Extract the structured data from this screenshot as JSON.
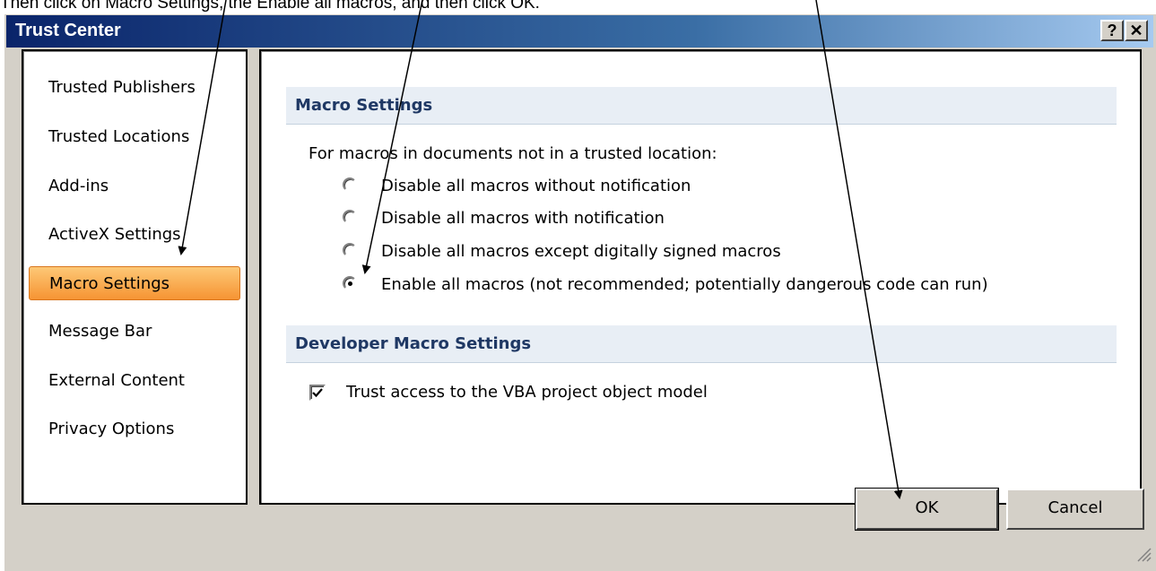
{
  "instruction": "Then click on Macro Settings, the Enable all macros, and then click OK.",
  "window": {
    "title": "Trust Center",
    "help_label": "?",
    "close_label": "✕"
  },
  "nav": {
    "items": [
      {
        "label": "Trusted Publishers"
      },
      {
        "label": "Trusted Locations"
      },
      {
        "label": "Add-ins"
      },
      {
        "label": "ActiveX Settings"
      },
      {
        "label": "Macro Settings",
        "selected": true
      },
      {
        "label": "Message Bar"
      },
      {
        "label": "External Content"
      },
      {
        "label": "Privacy Options"
      }
    ]
  },
  "macro_settings": {
    "header": "Macro Settings",
    "intro": "For macros in documents not in a trusted location:",
    "options": [
      {
        "label": "Disable all macros without notification",
        "checked": false
      },
      {
        "label": "Disable all macros with notification",
        "checked": false
      },
      {
        "label": "Disable all macros except digitally signed macros",
        "checked": false
      },
      {
        "label": "Enable all macros (not recommended; potentially dangerous code can run)",
        "checked": true
      }
    ]
  },
  "developer_settings": {
    "header": "Developer Macro Settings",
    "vba_label": "Trust access to the VBA project object model",
    "vba_checked": true
  },
  "buttons": {
    "ok": "OK",
    "cancel": "Cancel"
  },
  "colors": {
    "title_gradient_start": "#0a246a",
    "selected_nav": "#f69433",
    "section_header_bg": "#e8eef5",
    "section_header_text": "#1f3864"
  }
}
